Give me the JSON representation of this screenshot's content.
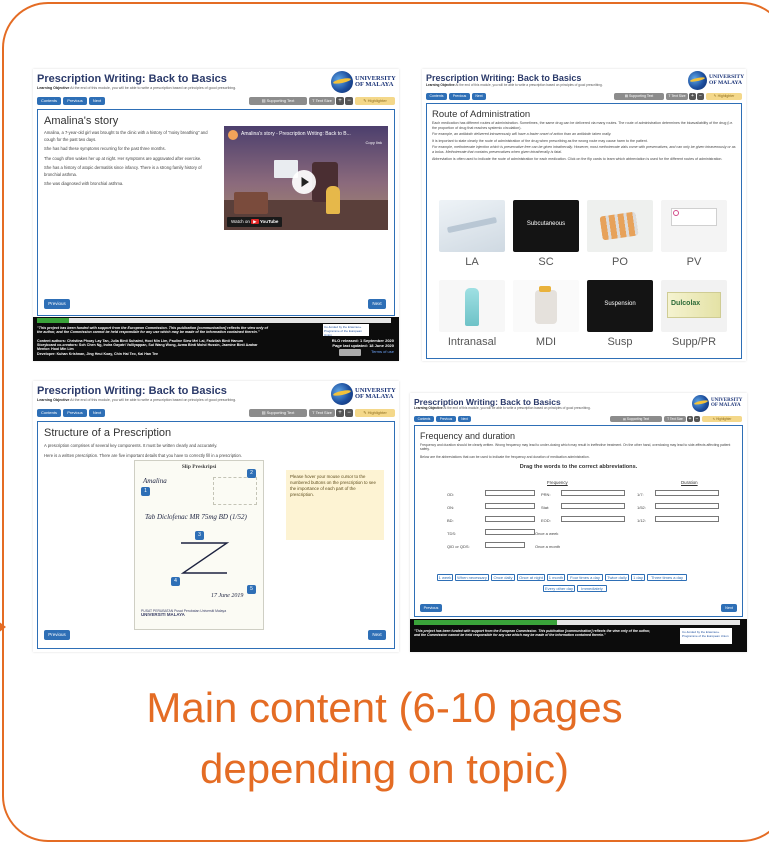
{
  "caption": {
    "line1": "Main content (6-10 pages",
    "line2": "depending on topic)"
  },
  "colors": {
    "accent_orange": "#e46c24",
    "nav_blue": "#2e6fb6",
    "progress_green": "#3aa33a",
    "footer": "#0c0c0c"
  },
  "module": {
    "title": "Prescription Writing: Back to Basics",
    "learning_objective_label": "Learning Objective",
    "learning_objective": "At the end of this module, you will be able to write a prescription based on principles of good prescribing.",
    "logo_line1": "UNIVERSITY",
    "logo_line2": "OF MALAYA",
    "nav": {
      "contents": "Contents",
      "previous": "Previous",
      "next": "Next"
    },
    "tools": {
      "supporting_text": "Supporting Text",
      "text_size": "Text Size",
      "plus": "+",
      "minus": "−",
      "highlighter": "Highlighter"
    },
    "buttons": {
      "previous": "Previous",
      "next": "Next"
    },
    "footer": {
      "funding": "\"This project has been funded with support from the European Commission. This publication [communication] reflects the view only of the author, and the Commission cannot be held responsible for any use which may be made of the information contained therein.\"",
      "authors": "Content authors: Christina Phoay Lay Tan, Julia Binti Suhaimi, Hooi Min Lim, Pauline Siew Mei Lai, Fadzilah Binti Hanum",
      "storyboard": "Storyboard co-creators: Soh Chen Ng, Indra Gayatri Valliyappan, Sui Wang Wong, Azma Binti Mohd Hussin, Jazmine Binti Azahar",
      "mentor": "Mentor: Hooi Min Lim",
      "developer": "Developer: Kuhan Krishnan, Jing Heui Koay, Chin Hai Teo, Kai Han Tee",
      "eu": "Co-funded by the Erasmus+ Programme of the European Union",
      "released": "RLO released: 1 September 2020",
      "updated": "Page last updated: 18 June 2020",
      "terms": "Terms of use"
    }
  },
  "pages": {
    "story": {
      "title": "Amalina's story",
      "p1": "Amalina, a 7-year-old girl was brought to the clinic with a history of \"noisy breathing\" and cough for the past two days.",
      "p2": "She has had these symptoms recurring for the past three months.",
      "p3": "The cough often wakes her up at night. Her symptoms are aggravated after exercise.",
      "p4": "She has a history of atopic dermatitis since infancy. There is a strong family history of bronchial asthma.",
      "p5": "She was diagnosed with bronchial asthma.",
      "video_title": "Amalina's story - Prescription Writing: Back to B...",
      "video_copy": "Copy link",
      "watch_on": "Watch on",
      "youtube": "YouTube"
    },
    "route": {
      "title": "Route of Administration",
      "p1": "Each medication has different routes of administration. Sometimes, the same drug can be delivered via many routes. The route of administration determines the bioavailability of the drug (i.e. the proportion of drug that reaches systemic circulation).",
      "p2": "For example, an antibiotic delivered intravenously will have a faster onset of action than an antibiotic taken orally.",
      "p3": "It is important to state clearly the route of administration of the drug when prescribing as the wrong route may cause harm to the patient.",
      "p4": "For example, methotrexate injection which is preservative free can be given intrathecally. However, most methotrexate vials come with preservatives, and can only be given intravenously or as a bolus. Methotrexate that contains preservatives when given intrathecally is fatal.",
      "p5": "Abbreviation is often used to indicate the route of administration for each medication. Click on the flip cards to learn which abbreviation is used for the different routes of administration.",
      "cards": [
        {
          "label": "LA",
          "overlay": ""
        },
        {
          "label": "SC",
          "overlay": "Subcutaneous"
        },
        {
          "label": "PO",
          "overlay": ""
        },
        {
          "label": "PV",
          "overlay": ""
        },
        {
          "label": "Intranasal",
          "overlay": ""
        },
        {
          "label": "MDI",
          "overlay": ""
        },
        {
          "label": "Susp",
          "overlay": "Suspension"
        },
        {
          "label": "Supp/PR",
          "overlay": ""
        }
      ],
      "dulcolax": "Dulcolax"
    },
    "structure": {
      "title": "Structure of a Prescription",
      "p1": "A prescription comprises of several key components. It must be written clearly and accurately.",
      "p2": "Here is a written prescription. There are five important details that you have to correctly fill in a prescription.",
      "hint": "Please hover your mouse cursor to the numbered buttons on the prescription to see the importance of each part of the prescription.",
      "rx_header": "Slip Preskripsi",
      "rx_name": "Amalina",
      "rx_line1": "Tab Diclofenac MR 75mg BD (1/52)",
      "rx_date": "17 June 2019",
      "rx_hospital": "PUSAT PERUBATAN Pusat Perubatan Universiti Malaya",
      "rx_university": "UNIVERSITI MALAYA",
      "markers": [
        "1",
        "2",
        "3",
        "4",
        "5"
      ]
    },
    "frequency": {
      "title": "Frequency and duration",
      "p1": "Frequency and duration should be clearly written. Wrong frequency may lead to under-dosing which may result in ineffective treatment. On the other hand, overdosing may lead to side-effects affecting patient safety.",
      "p2": "Below are the abbreviations that can be used to indicate the frequency and duration of medication administration.",
      "instruction": "Drag the words to the correct abbreviations.",
      "freq_heading": "Frequency",
      "dur_heading": "Duration",
      "rows_left": [
        "OD:",
        "ON:",
        "BD:",
        "TDS:",
        "QID or QDS:"
      ],
      "rows_mid": [
        "PRN:",
        "Stat:",
        "EOD:",
        "Once a week",
        "Once a month"
      ],
      "rows_right": [
        "1/7:",
        "1/52:",
        "1/12:"
      ],
      "chips_row1": [
        "1 week",
        "When necessary",
        "Once daily",
        "Once at night",
        "1 month",
        "Four times a day",
        "Twice daily",
        "1 day",
        "Three times a day"
      ],
      "chips_row2": [
        "Every other day",
        "Immediately"
      ]
    }
  }
}
